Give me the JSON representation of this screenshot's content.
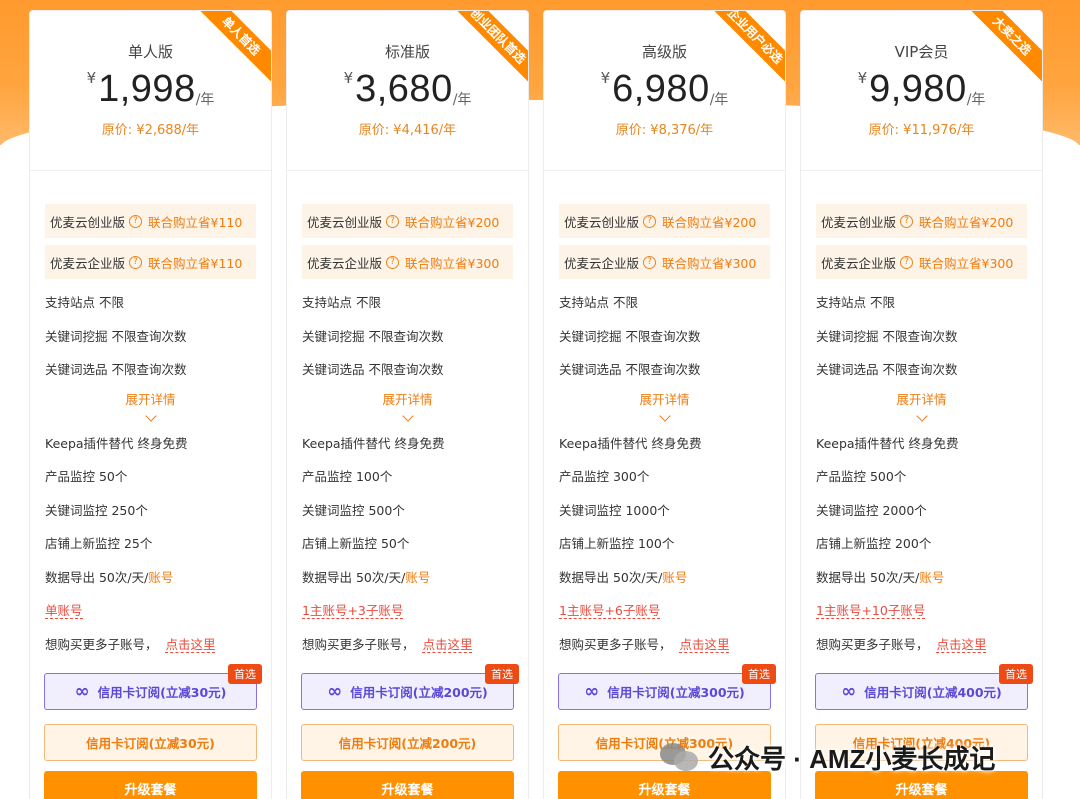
{
  "plans": [
    {
      "ribbon": "单人首选",
      "name": "单人版",
      "currency": "¥",
      "price": "1,998",
      "unit": "/年",
      "original": "原价: ¥2,688/年",
      "promos": [
        {
          "name": "优麦云创业版",
          "discount": "联合购立省¥110"
        },
        {
          "name": "优麦云企业版",
          "discount": "联合购立省¥110"
        }
      ],
      "features_top": [
        "支持站点  不限",
        "关键词挖掘  不限查询次数",
        "关键词选品  不限查询次数"
      ],
      "expand_label": "展开详情",
      "features_bottom": [
        "Keepa插件替代  终身免费",
        "产品监控  50个",
        "关键词监控  250个",
        "店铺上新监控  25个"
      ],
      "export_prefix": "数据导出  50次/天/",
      "export_suffix": "账号",
      "account_label": "单账号",
      "more_text": "想购买更多子账号，",
      "more_link": "点击这里",
      "card_btn": "信用卡订阅(立减30元)",
      "badge": "首选",
      "credit_btn": "信用卡订阅(立减30元)",
      "upgrade_btn": "升级套餐"
    },
    {
      "ribbon": "创业团队首选",
      "name": "标准版",
      "currency": "¥",
      "price": "3,680",
      "unit": "/年",
      "original": "原价: ¥4,416/年",
      "promos": [
        {
          "name": "优麦云创业版",
          "discount": "联合购立省¥200"
        },
        {
          "name": "优麦云企业版",
          "discount": "联合购立省¥300"
        }
      ],
      "features_top": [
        "支持站点  不限",
        "关键词挖掘  不限查询次数",
        "关键词选品  不限查询次数"
      ],
      "expand_label": "展开详情",
      "features_bottom": [
        "Keepa插件替代  终身免费",
        "产品监控  100个",
        "关键词监控  500个",
        "店铺上新监控  50个"
      ],
      "export_prefix": "数据导出  50次/天/",
      "export_suffix": "账号",
      "account_label": "1主账号+3子账号",
      "more_text": "想购买更多子账号，",
      "more_link": "点击这里",
      "card_btn": "信用卡订阅(立减200元)",
      "badge": "首选",
      "credit_btn": "信用卡订阅(立减200元)",
      "upgrade_btn": "升级套餐"
    },
    {
      "ribbon": "企业用户必选",
      "name": "高级版",
      "currency": "¥",
      "price": "6,980",
      "unit": "/年",
      "original": "原价: ¥8,376/年",
      "promos": [
        {
          "name": "优麦云创业版",
          "discount": "联合购立省¥200"
        },
        {
          "name": "优麦云企业版",
          "discount": "联合购立省¥300"
        }
      ],
      "features_top": [
        "支持站点  不限",
        "关键词挖掘  不限查询次数",
        "关键词选品  不限查询次数"
      ],
      "expand_label": "展开详情",
      "features_bottom": [
        "Keepa插件替代  终身免费",
        "产品监控  300个",
        "关键词监控  1000个",
        "店铺上新监控  100个"
      ],
      "export_prefix": "数据导出  50次/天/",
      "export_suffix": "账号",
      "account_label": "1主账号+6子账号",
      "more_text": "想购买更多子账号，",
      "more_link": "点击这里",
      "card_btn": "信用卡订阅(立减300元)",
      "badge": "首选",
      "credit_btn": "信用卡订阅(立减300元)",
      "upgrade_btn": "升级套餐"
    },
    {
      "ribbon": "大卖之选",
      "name": "VIP会员",
      "currency": "¥",
      "price": "9,980",
      "unit": "/年",
      "original": "原价: ¥11,976/年",
      "promos": [
        {
          "name": "优麦云创业版",
          "discount": "联合购立省¥200"
        },
        {
          "name": "优麦云企业版",
          "discount": "联合购立省¥300"
        }
      ],
      "features_top": [
        "支持站点  不限",
        "关键词挖掘  不限查询次数",
        "关键词选品  不限查询次数"
      ],
      "expand_label": "展开详情",
      "features_bottom": [
        "Keepa插件替代  终身免费",
        "产品监控  500个",
        "关键词监控  2000个",
        "店铺上新监控  200个"
      ],
      "export_prefix": "数据导出  50次/天/",
      "export_suffix": "账号",
      "account_label": "1主账号+10子账号",
      "more_text": "想购买更多子账号，",
      "more_link": "点击这里",
      "card_btn": "信用卡订阅(立减400元)",
      "badge": "首选",
      "credit_btn": "信用卡订阅(立减400元)",
      "upgrade_btn": "升级套餐"
    }
  ],
  "watermark": {
    "text": "公众号 · AMZ小麦长成记"
  },
  "colors": {
    "accent": "#ff9100",
    "promo_text": "#ee7d10",
    "link_red": "#e84c3d",
    "card_btn": "#5b48d6"
  }
}
